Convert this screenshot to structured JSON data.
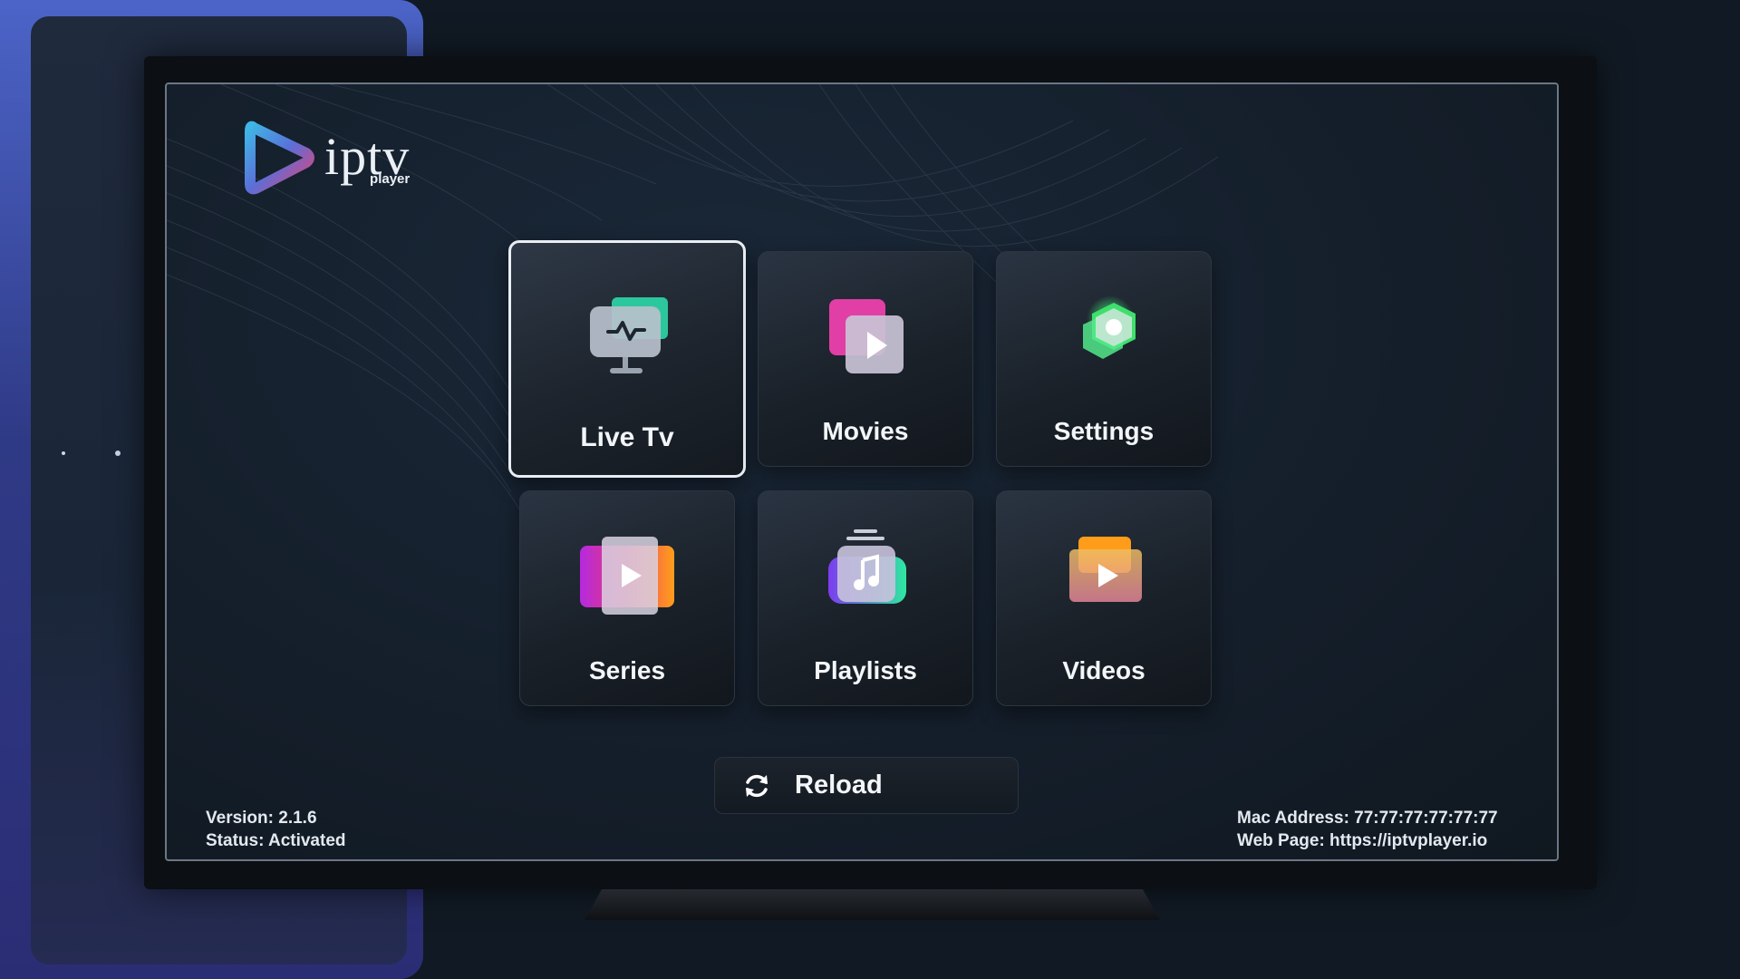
{
  "app": {
    "logo_name": "iptv",
    "logo_sub": "player"
  },
  "menu": {
    "tiles": [
      {
        "label": "Live Tv",
        "icon": "live-tv-icon",
        "active": true
      },
      {
        "label": "Movies",
        "icon": "movies-icon",
        "active": false
      },
      {
        "label": "Settings",
        "icon": "settings-icon",
        "active": false
      },
      {
        "label": "Series",
        "icon": "series-icon",
        "active": false
      },
      {
        "label": "Playlists",
        "icon": "playlists-icon",
        "active": false
      },
      {
        "label": "Videos",
        "icon": "videos-icon",
        "active": false
      }
    ]
  },
  "reload": {
    "label": "Reload",
    "icon": "refresh-icon"
  },
  "footer": {
    "version": "Version: 2.1.6",
    "status": "Status: Activated",
    "mac": "Mac Address: 77:77:77:77:77:77",
    "web": "Web Page: https://iptvplayer.io"
  },
  "colors": {
    "background": "#111a24",
    "accent_panel": "#3e52b0",
    "tile_border_active": "#e9eef4",
    "text": "#ffffff"
  }
}
